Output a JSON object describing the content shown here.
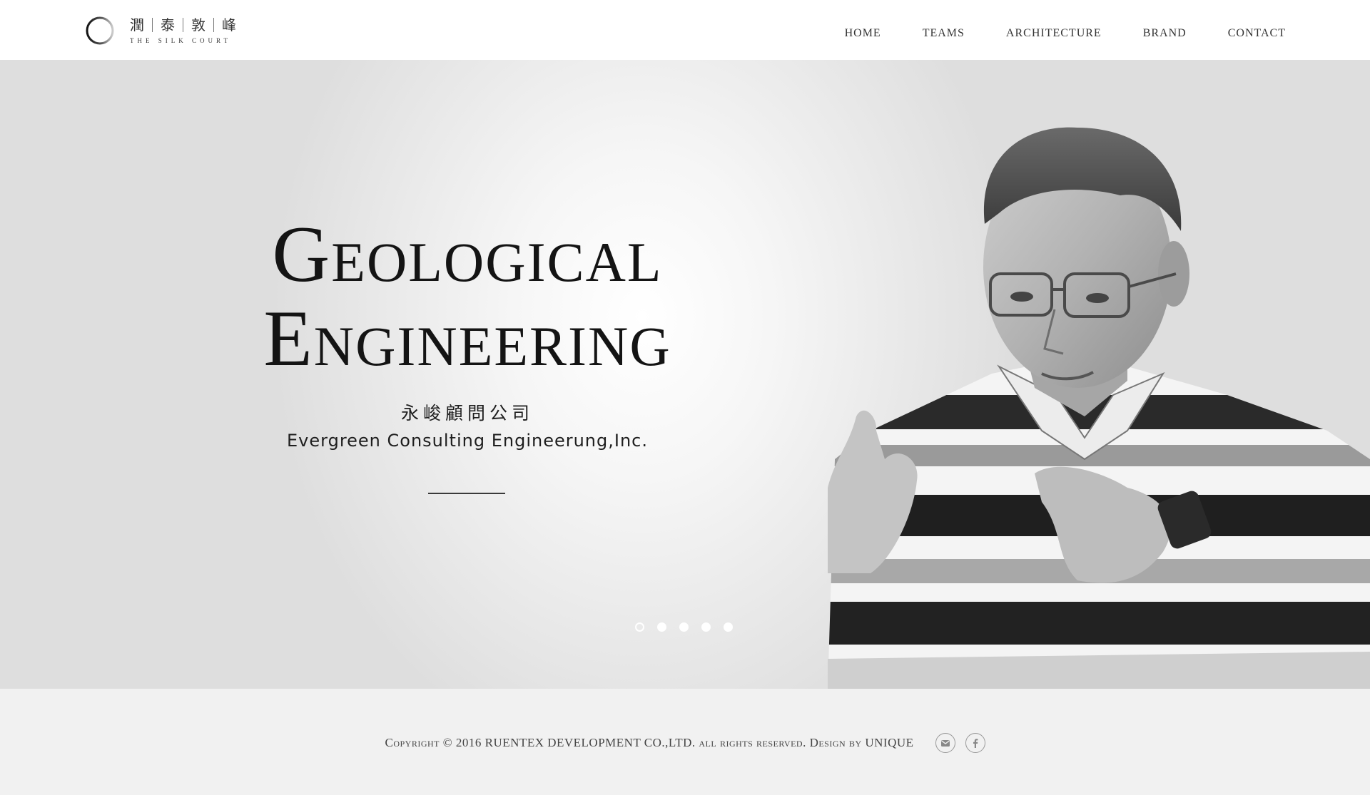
{
  "header": {
    "logo": {
      "cn_chars": [
        "潤",
        "泰",
        "敦",
        "峰"
      ],
      "en": "The Silk Court"
    },
    "nav": [
      {
        "label": "HOME"
      },
      {
        "label": "TEAMS"
      },
      {
        "label": "ARCHITECTURE"
      },
      {
        "label": "BRAND"
      },
      {
        "label": "CONTACT"
      }
    ]
  },
  "hero": {
    "title_line1": "Geological",
    "title_line2": "Engineering",
    "subtitle_cn": "永峻顧問公司",
    "subtitle_en": "Evergreen Consulting Engineerung,Inc.",
    "slides_total": 5,
    "active_slide": 1
  },
  "footer": {
    "copyright": "Copyright © 2016 RUENTEX DEVELOPMENT CO.,LTD. all rights reserved. Design by UNIQUE",
    "social": [
      {
        "icon": "mail-icon"
      },
      {
        "icon": "facebook-icon"
      }
    ]
  },
  "colors": {
    "header_bg": "#ffffff",
    "footer_bg": "#f1f1f1",
    "text": "#1a1a1a"
  }
}
